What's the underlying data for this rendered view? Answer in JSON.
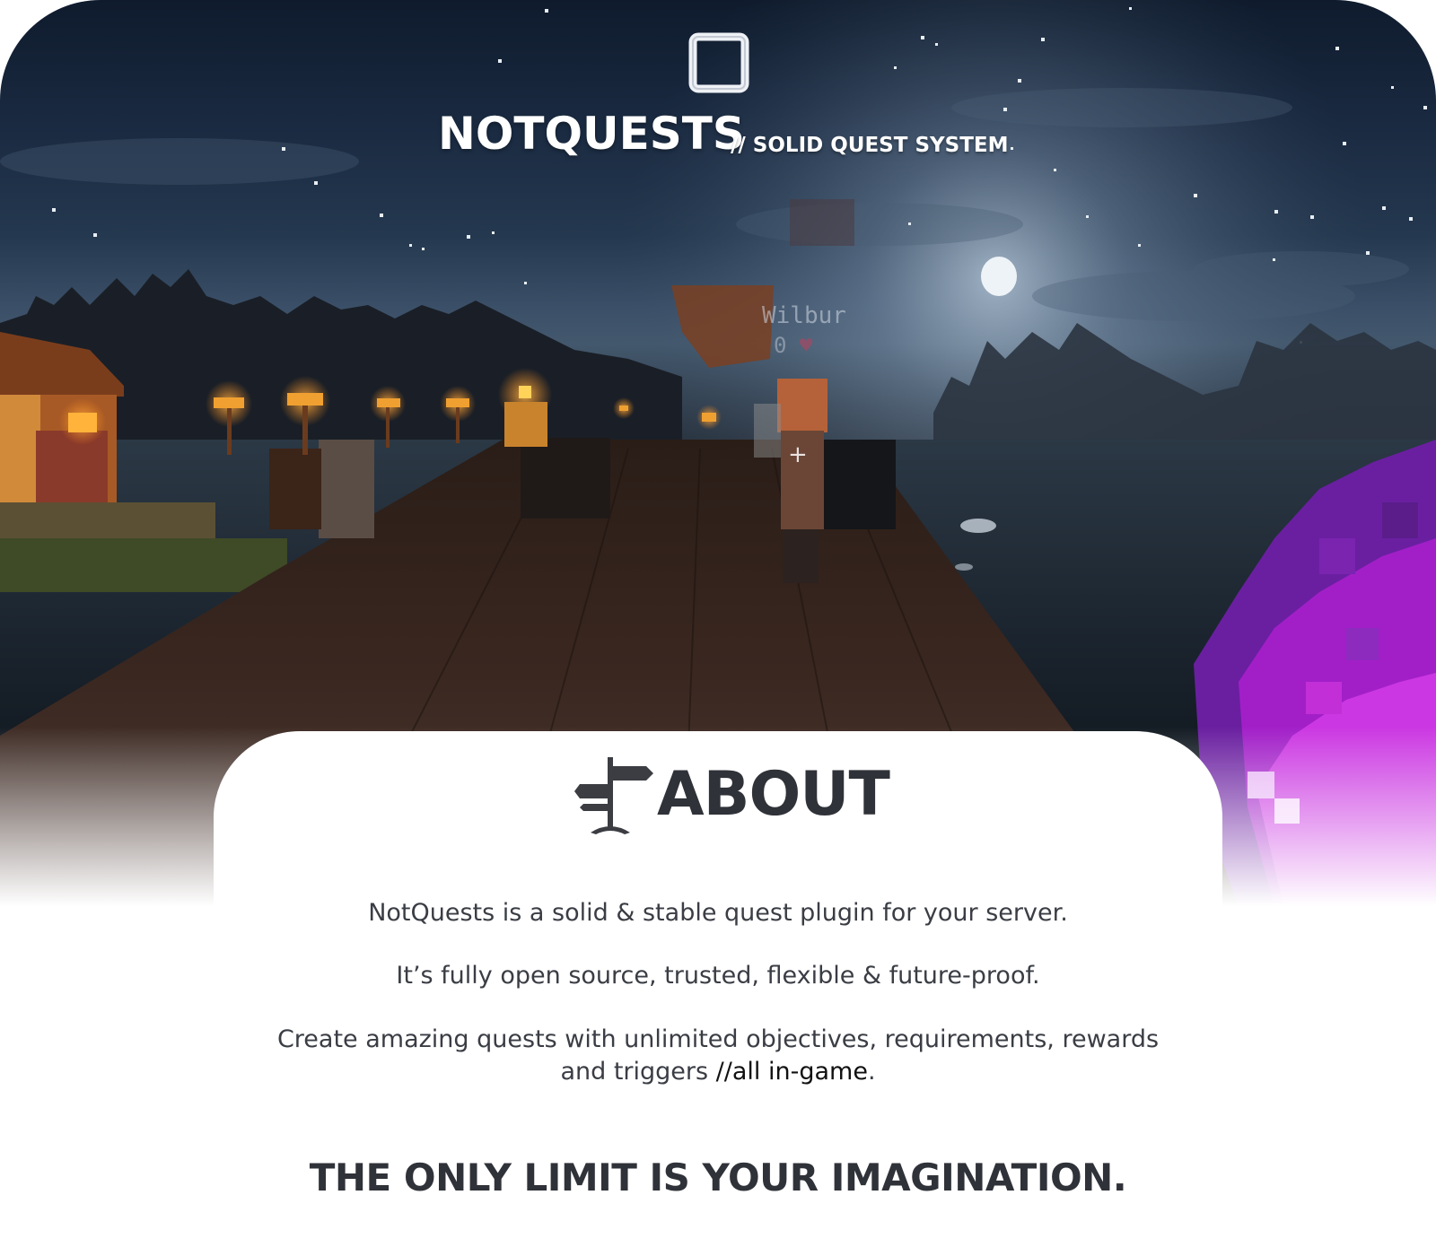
{
  "hero": {
    "brand": {
      "title": "NOTQUESTS",
      "tagline": "// SOLID QUEST SYSTEM"
    },
    "npc": {
      "name": "Wilbur",
      "count": "0"
    },
    "icons": {
      "logo": "square-logo-icon",
      "crosshair": "crosshair-icon",
      "heart": "heart-icon",
      "held_item": "ender-pearl-icon"
    }
  },
  "about": {
    "icon": "signpost-icon",
    "heading": "ABOUT",
    "paragraphs": [
      "NotQuests is a solid & stable quest plugin for your server.",
      "It’s fully open source, trusted, flexible & future-proof."
    ],
    "paragraph3": {
      "line1": "Create amazing quests with unlimited objectives, requirements, rewards",
      "line2_start": "and triggers ",
      "line2_accent": "//all in-game",
      "line2_end": "."
    },
    "slogan": "THE ONLY LIMIT IS YOUR IMAGINATION."
  },
  "colors": {
    "heading": "#2f3238",
    "body_text": "#3a3d44",
    "brand_text": "#ffffff",
    "lantern": "#f0a030",
    "pearl": "#b02ad0"
  }
}
